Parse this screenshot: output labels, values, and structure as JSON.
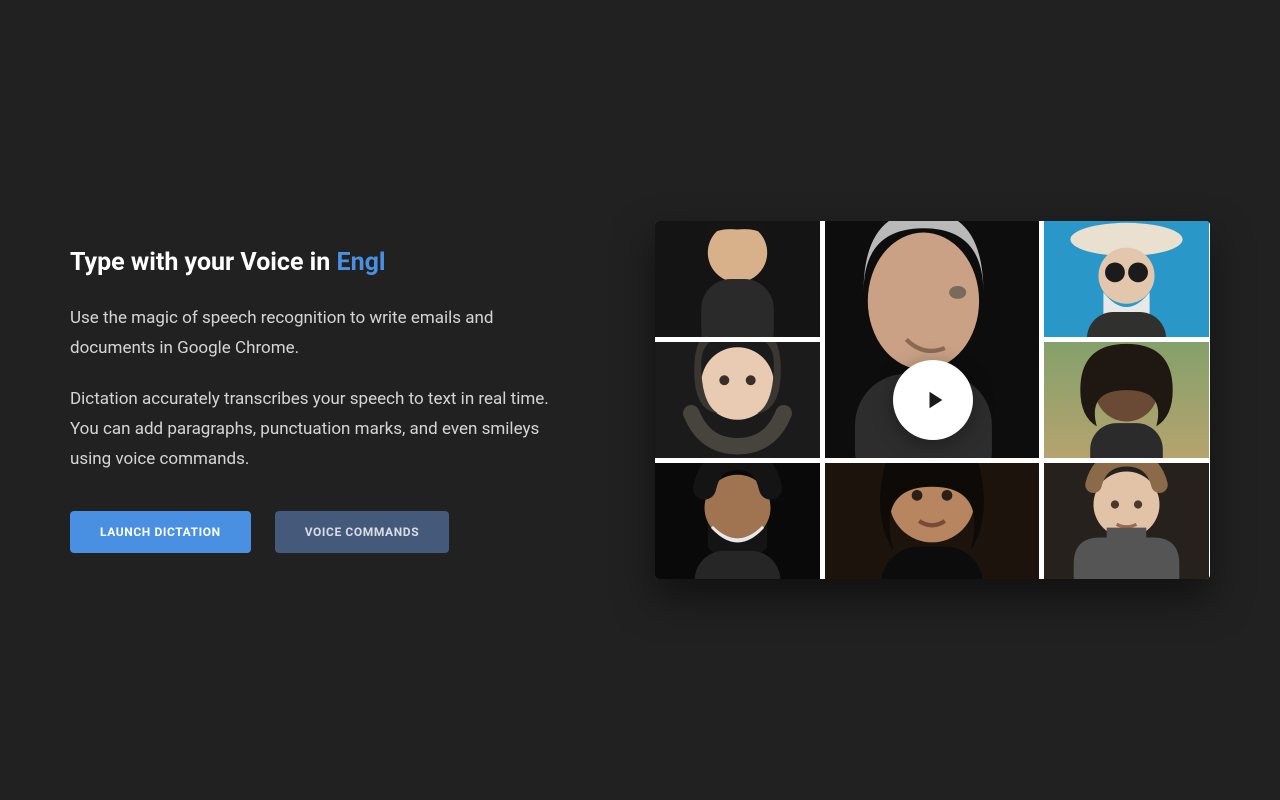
{
  "hero": {
    "title_prefix": "Type with your Voice in ",
    "title_accent": "Engl",
    "paragraph1": "Use the magic of speech recognition to write emails and documents in Google Chrome.",
    "paragraph2": "Dictation accurately transcribes your speech to text in real time. You can add paragraphs, punctuation marks, and even smileys using voice commands."
  },
  "buttons": {
    "primary_label": "Launch Dictation",
    "secondary_label": "Voice Commands"
  },
  "video": {
    "play_label": "Play video"
  },
  "colors": {
    "accent": "#4a90e2",
    "background": "#212121",
    "button_secondary": "#455a7a"
  }
}
